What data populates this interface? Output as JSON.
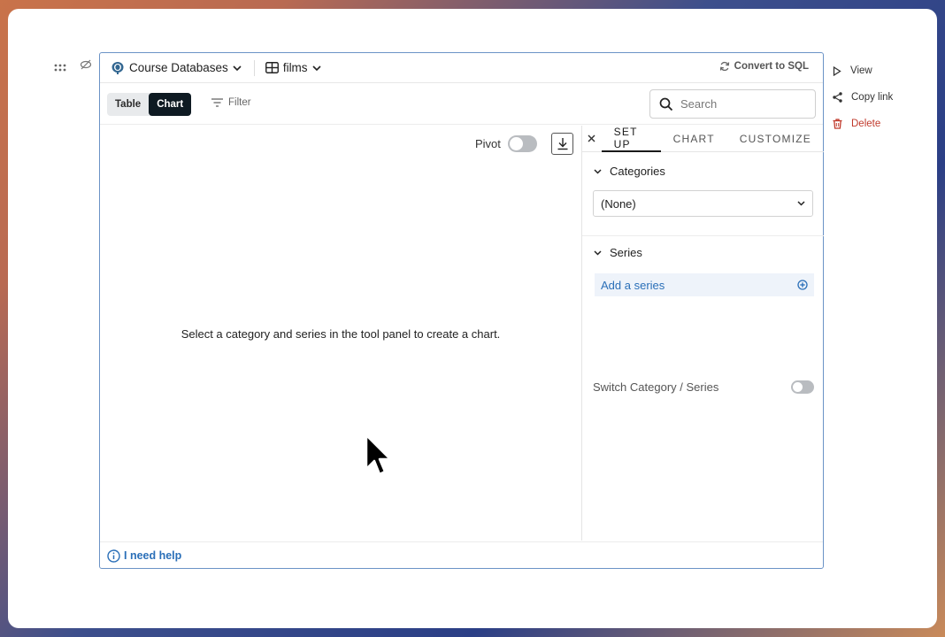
{
  "cell": {
    "database": "Course Databases",
    "table": "films",
    "convert_label": "Convert to SQL",
    "view_tabs": [
      {
        "label": "Table",
        "active": false
      },
      {
        "label": "Chart",
        "active": true
      }
    ],
    "filter_label": "Filter",
    "search_placeholder": "Search"
  },
  "chart_area": {
    "pivot_label": "Pivot",
    "pivot_on": false,
    "empty_message": "Select a category and series in the tool panel to create a chart."
  },
  "tool_panel": {
    "tabs": [
      {
        "label": "SET UP",
        "active": true
      },
      {
        "label": "CHART",
        "active": false
      },
      {
        "label": "CUSTOMIZE",
        "active": false
      }
    ],
    "categories_label": "Categories",
    "category_value": "(None)",
    "series_label": "Series",
    "add_series_label": "Add a series",
    "switch_label": "Switch Category / Series",
    "switch_on": false
  },
  "footer": {
    "help_label": "I need help"
  },
  "actions": [
    {
      "label": "View",
      "icon": "play-icon"
    },
    {
      "label": "Copy link",
      "icon": "share-icon"
    },
    {
      "label": "Delete",
      "icon": "trash-icon"
    }
  ],
  "colors": {
    "accent": "#2a6fb8",
    "active_tab_bg": "#0e1a22",
    "danger": "#c0392b",
    "cell_border": "#6b93c6"
  }
}
